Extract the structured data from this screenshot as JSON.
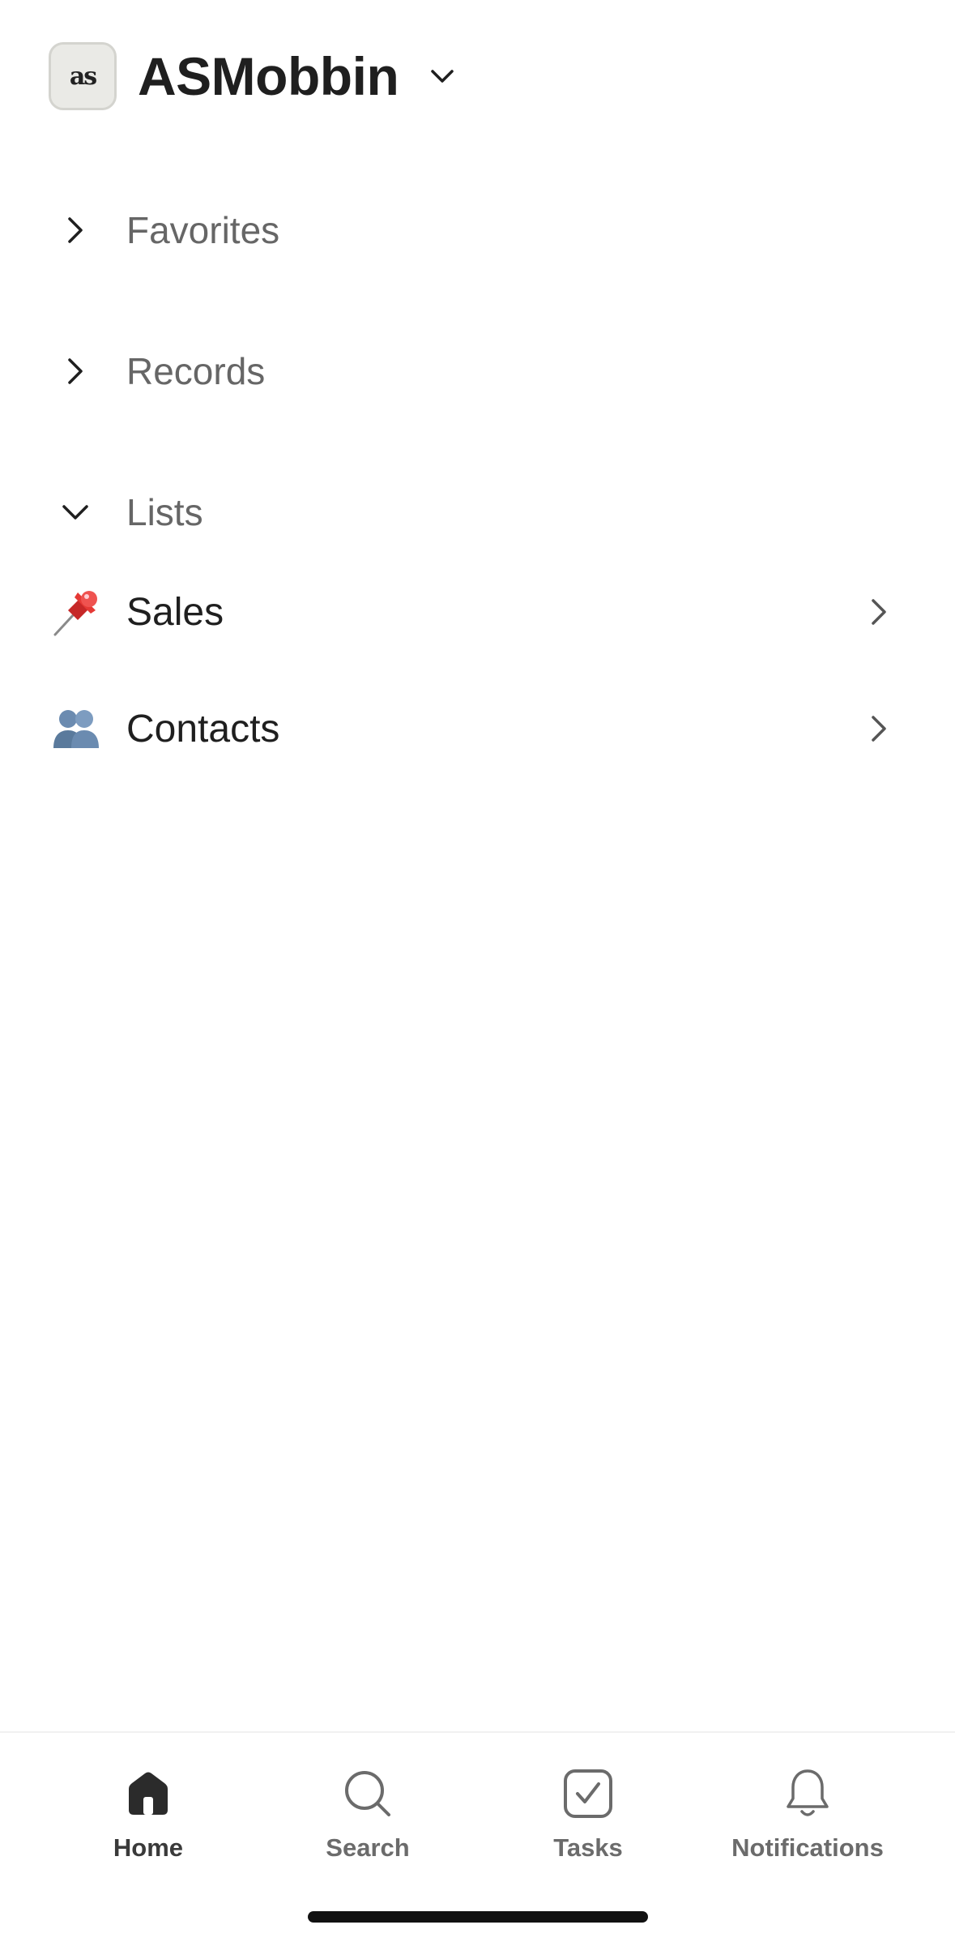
{
  "header": {
    "workspace_name": "ASMobbin",
    "avatar_text": "as",
    "chevron_icon": "chevron-down-icon"
  },
  "sections": {
    "favorites": {
      "label": "Favorites",
      "expanded": false,
      "icon": "chevron-right-icon"
    },
    "records": {
      "label": "Records",
      "expanded": false,
      "icon": "chevron-right-icon"
    },
    "lists": {
      "label": "Lists",
      "expanded": true,
      "icon": "chevron-down-icon"
    }
  },
  "lists": {
    "items": [
      {
        "emoji": "📌",
        "label": "Sales",
        "icon": "pushpin-icon"
      },
      {
        "emoji": "👥",
        "label": "Contacts",
        "icon": "people-icon"
      }
    ]
  },
  "tab_bar": {
    "tabs": [
      {
        "label": "Home",
        "icon": "home-icon",
        "active": true
      },
      {
        "label": "Search",
        "icon": "search-icon",
        "active": false
      },
      {
        "label": "Tasks",
        "icon": "tasks-check-icon",
        "active": false
      },
      {
        "label": "Notifications",
        "icon": "bell-icon",
        "active": false
      }
    ]
  },
  "colors": {
    "text_primary": "#1f1f1f",
    "text_secondary": "#666666",
    "tab_active": "#2b2b2b",
    "tab_inactive": "#6b6b6b",
    "background": "#ffffff",
    "pushpin_red": "#d32f2f",
    "people_blue": "#5a7a9c"
  }
}
